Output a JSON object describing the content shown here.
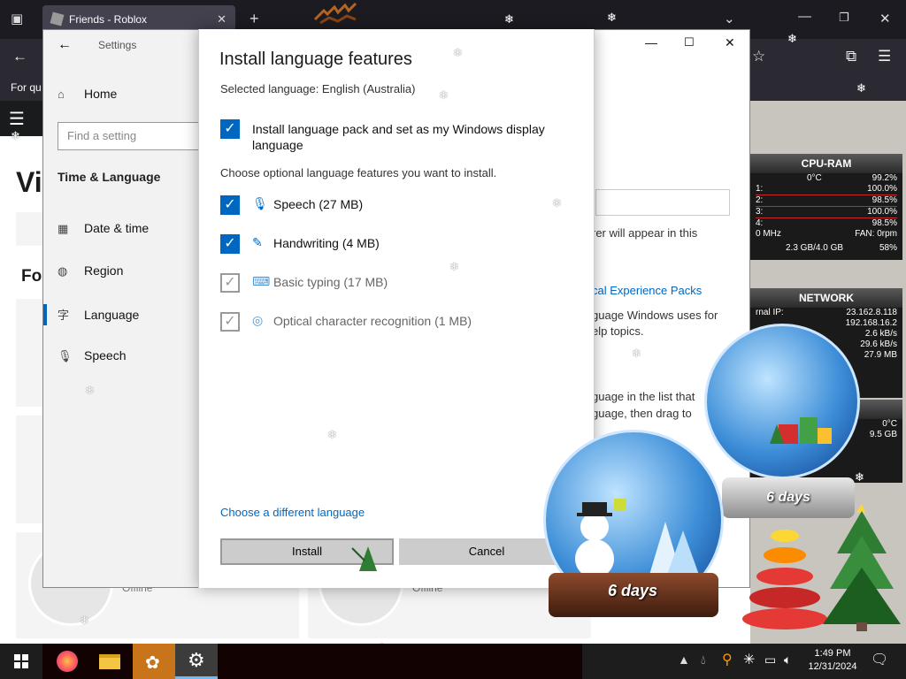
{
  "browser": {
    "tab_title": "Friends - Roblox",
    "bookmark_text": "For qu"
  },
  "roblox": {
    "title_partial": "Vi",
    "section_partial": "Fo",
    "status_left": "Offline",
    "status_right": "Offline"
  },
  "settings": {
    "window_title": "Settings",
    "sidebar": {
      "home": "Home",
      "search_placeholder": "Find a setting",
      "section": "Time & Language",
      "items": [
        "Date & time",
        "Region",
        "Language",
        "Speech"
      ]
    },
    "right_text": {
      "r1": "rer will appear in this",
      "r2": "cal Experience Packs",
      "r3": "guage Windows uses for",
      "r4": "elp topics.",
      "r5": "guage in the list that",
      "r6": "guage, then drag to"
    }
  },
  "dialog": {
    "title": "Install language features",
    "selected_language": "Selected language: English (Australia)",
    "main_option": "Install language pack and set as my Windows display language",
    "optional_header": "Choose optional language features you want to install.",
    "features": [
      {
        "label": "Speech (27 MB)",
        "checked": true,
        "icon": "microphone-icon"
      },
      {
        "label": "Handwriting (4 MB)",
        "checked": true,
        "icon": "pen-icon"
      },
      {
        "label": "Basic typing (17 MB)",
        "checked": true,
        "icon": "keyboard-icon"
      },
      {
        "label": "Optical character recognition (1 MB)",
        "checked": true,
        "icon": "ocr-icon"
      }
    ],
    "link": "Choose a different language",
    "install": "Install",
    "cancel": "Cancel"
  },
  "gadgets": {
    "cpu": {
      "title": "CPU-RAM",
      "temp": "0°C",
      "total": "99.2%",
      "cores": [
        {
          "label": "1:",
          "value": "100.0%"
        },
        {
          "label": "2:",
          "value": "98.5%"
        },
        {
          "label": "3:",
          "value": "100.0%"
        },
        {
          "label": "4:",
          "value": "98.5%"
        }
      ],
      "freq": "0 MHz",
      "fan": "FAN: 0rpm",
      "ram": "2.3 GB/4.0 GB",
      "ram_pct": "58%"
    },
    "network": {
      "title": "NETWORK",
      "ext_ip_label": "rnal IP:",
      "ext_ip": "23.162.8.118",
      "int_ip": "192.168.16.2",
      "down": "2.6 kB/s",
      "up": "29.6 kB/s",
      "total": "27.9 MB"
    },
    "drive": {
      "temp": "0°C",
      "size": "9.5 GB"
    }
  },
  "globes": {
    "front_plaque": "6 days",
    "back_plaque": "6 days"
  },
  "taskbar": {
    "time": "1:49 PM",
    "date": "12/31/2024"
  },
  "colors": {
    "accent": "#0067c0",
    "taskbar": "#1d1d1d",
    "browser": "#2b2a33"
  }
}
